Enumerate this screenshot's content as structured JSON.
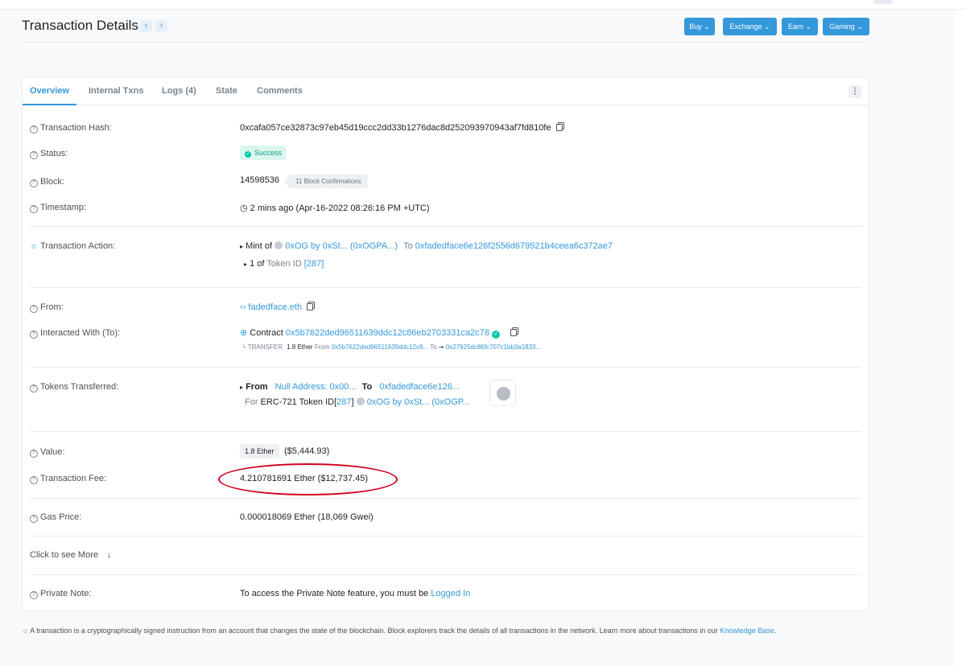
{
  "page": {
    "title": "Transaction Details",
    "prev_icon": "chevron-left-icon",
    "next_icon": "chevron-right-icon"
  },
  "top_buttons": {
    "buy": "Buy",
    "exchange": "Exchange",
    "earn": "Earn",
    "gaming": "Gaming"
  },
  "tabs": [
    "Overview",
    "Internal Txns",
    "Logs (4)",
    "State",
    "Comments"
  ],
  "rows": {
    "tx_hash": {
      "label": "Transaction Hash:",
      "value": "0xcafa057ce32873c97eb45d19ccc2dd33b1276dac8d252093970943af7fd810fe"
    },
    "status": {
      "label": "Status:",
      "value": "Success"
    },
    "block": {
      "label": "Block:",
      "number": "14598536",
      "confirmations": "11 Block Confirmations"
    },
    "timestamp": {
      "label": "Timestamp:",
      "value": "2 mins ago (Apr-16-2022 08:26:16 PM +UTC)"
    },
    "action": {
      "label": "Transaction Action:",
      "mint_of": "Mint of",
      "token_name": "0xOG by 0xSt... (0xOGPA...)",
      "to": "To",
      "to_address": "0xfadedface6e126f2556d679521b4ceea6c372ae7",
      "qty": "1 of",
      "token_id_label": "Token ID",
      "token_id": "[287]"
    },
    "from": {
      "label": "From:",
      "value": "fadedface.eth"
    },
    "interacted": {
      "label": "Interacted With (To):",
      "contract": "Contract",
      "address": "0x5b7622ded96511639ddc12c86eb2703331ca2c78",
      "transfer": "TRANSFER",
      "amount": "1.8 Ether",
      "from": "From",
      "from_address": "0x5b7622ded96511639ddc12c8...",
      "to": "To",
      "to_address": "0x27925dc86fc707c1bb3a1833..."
    },
    "tokens": {
      "label": "Tokens Transferred:",
      "from": "From",
      "from_value": "Null Address: 0x00...",
      "to": "To",
      "to_value": "0xfadedface6e126...",
      "for": "For",
      "standard": "ERC-721 Token ID",
      "id_open": "[",
      "id": "287",
      "id_close": "]",
      "token_name": "0xOG by 0xSt... (0xOGP..."
    },
    "value": {
      "label": "Value:",
      "badge": "1.8 Ether",
      "usd": "($5,444.93)"
    },
    "fee": {
      "label": "Transaction Fee:",
      "value": "4.210781691 Ether ($12,737.45)"
    },
    "gas": {
      "label": "Gas Price:",
      "value": "0.000018069 Ether (18,069 Gwei)"
    },
    "more": {
      "label": "Click to see More"
    },
    "note": {
      "label": "Private Note:",
      "text": "To access the Private Note feature, you must be",
      "link": "Logged In"
    }
  },
  "footer": {
    "text": "A transaction is a cryptographically signed instruction from an account that changes the state of the blockchain. Block explorers track the details of all transactions in the network. Learn more about transactions in our",
    "link": "Knowledge Base",
    "end": "."
  },
  "colors": {
    "accent": "#3498db",
    "success": "#00c9a7",
    "annotation": "#d1001c"
  }
}
